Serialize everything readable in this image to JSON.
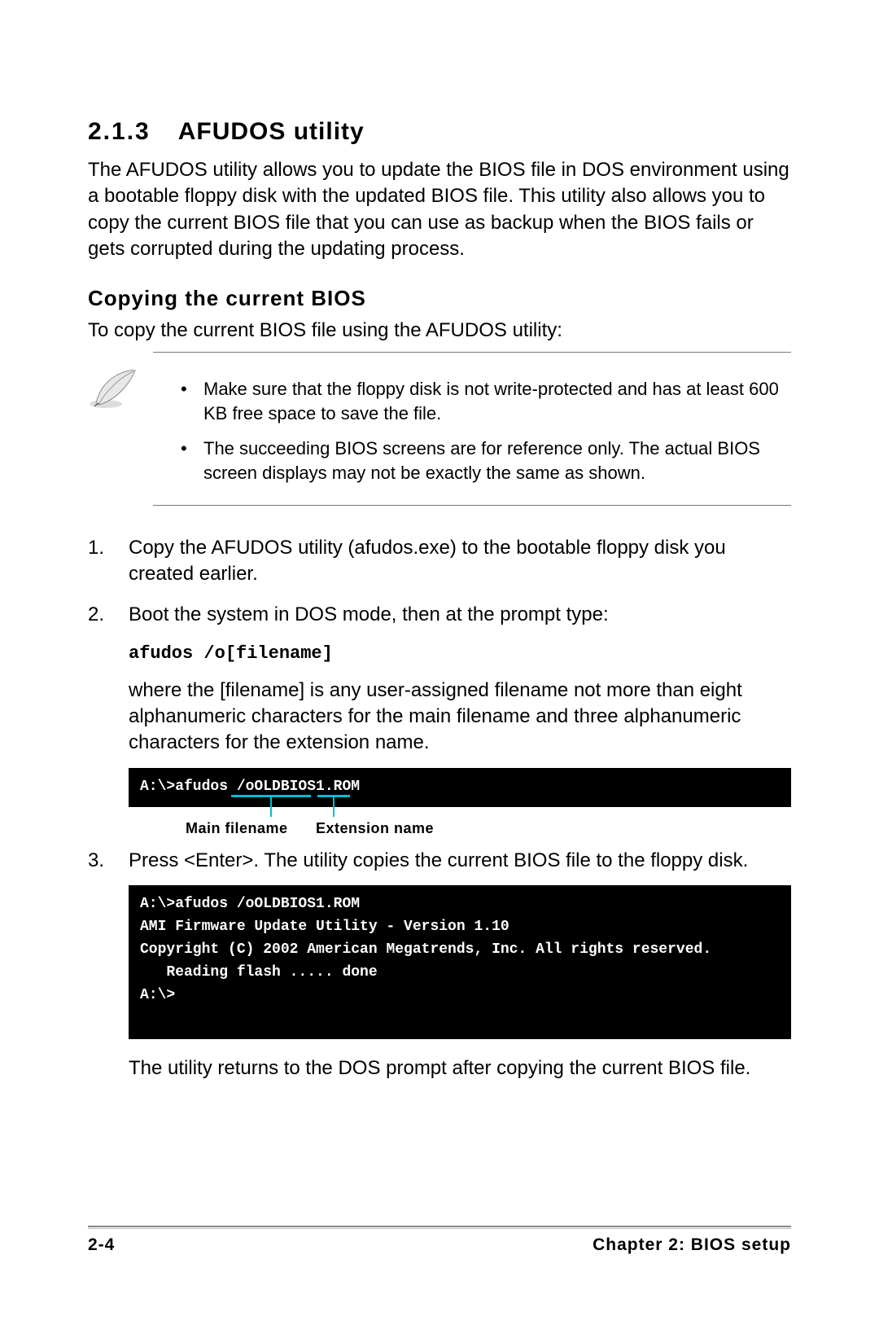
{
  "heading": {
    "number": "2.1.3",
    "title": "AFUDOS utility"
  },
  "intro": "The AFUDOS utility allows you to update the BIOS file in DOS environment using a bootable floppy disk with the updated BIOS file. This utility also allows you to copy the current BIOS file that you can use as backup when the BIOS fails or gets corrupted during the updating process.",
  "subheading": "Copying the current BIOS",
  "subintro": "To copy the current BIOS file using the AFUDOS utility:",
  "notes": [
    "Make sure that the floppy disk is not write-protected and has at least 600 KB free space to save the file.",
    "The succeeding BIOS screens are for reference only. The actual BIOS screen displays may not be exactly the same as shown."
  ],
  "steps": {
    "s1": "Copy the AFUDOS utility (afudos.exe) to the bootable floppy disk you created earlier.",
    "s2": "Boot the system in DOS mode, then at the prompt type:",
    "s2_cmd": "afudos /o[filename]",
    "s2_explain": "where the [filename] is any user-assigned filename not more than eight alphanumeric characters  for the main filename and three alphanumeric characters for the extension name.",
    "s2_term": "A:\\>afudos /oOLDBIOS1.ROM",
    "s2_anno_main": "Main filename",
    "s2_anno_ext": "Extension name",
    "s3": "Press <Enter>. The utility copies the current BIOS file to the floppy disk.",
    "s3_term": "A:\\>afudos /oOLDBIOS1.ROM\nAMI Firmware Update Utility - Version 1.10\nCopyright (C) 2002 American Megatrends, Inc. All rights reserved.\n   Reading flash ..... done\nA:\\>"
  },
  "outro": "The utility returns to the DOS prompt after copying the current BIOS file.",
  "footer": {
    "page": "2-4",
    "chapter": "Chapter 2: BIOS setup"
  }
}
